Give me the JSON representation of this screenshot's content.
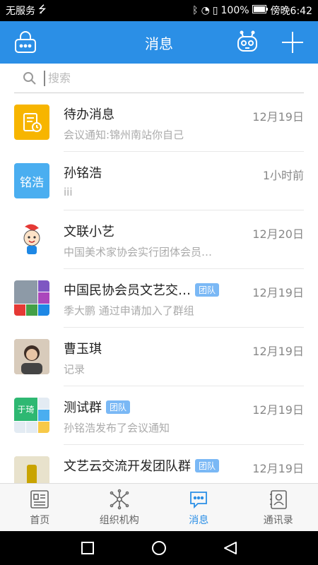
{
  "status": {
    "carrier": "无服务",
    "battery": "100%",
    "time": "傍晚6:42"
  },
  "header": {
    "title": "消息"
  },
  "search": {
    "placeholder": "搜索"
  },
  "messages": [
    {
      "name": "待办消息",
      "preview": "会议通知:锦州南站你自己",
      "time": "12月19日",
      "badge": ""
    },
    {
      "name": "孙铭浩",
      "preview": "iii",
      "time": "1小时前",
      "badge": "",
      "avatar_text": "铭浩"
    },
    {
      "name": "文联小艺",
      "preview": "中国美术家协会实行团体会员…",
      "time": "12月20日",
      "badge": ""
    },
    {
      "name": "中国民协会员文艺交…",
      "preview": "季大鹏 通过申请加入了群组",
      "time": "12月19日",
      "badge": "团队"
    },
    {
      "name": "曹玉琪",
      "preview": "记录",
      "time": "12月19日",
      "badge": ""
    },
    {
      "name": "测试群",
      "preview": "孙铭浩发布了会议通知",
      "time": "12月19日",
      "badge": "团队",
      "avatar_text": "于琦"
    },
    {
      "name": "文艺云交流开发团队群",
      "preview": "",
      "time": "12月19日",
      "badge": "团队"
    }
  ],
  "tabs": [
    {
      "label": "首页",
      "icon": "home-icon"
    },
    {
      "label": "组织机构",
      "icon": "org-icon"
    },
    {
      "label": "消息",
      "icon": "message-icon"
    },
    {
      "label": "通讯录",
      "icon": "contacts-icon"
    }
  ],
  "colors": {
    "primary": "#2b8fe6",
    "badge": "#7ab8f5",
    "todo_icon": "#f7b500",
    "avatar_blue": "#4aaef0"
  }
}
